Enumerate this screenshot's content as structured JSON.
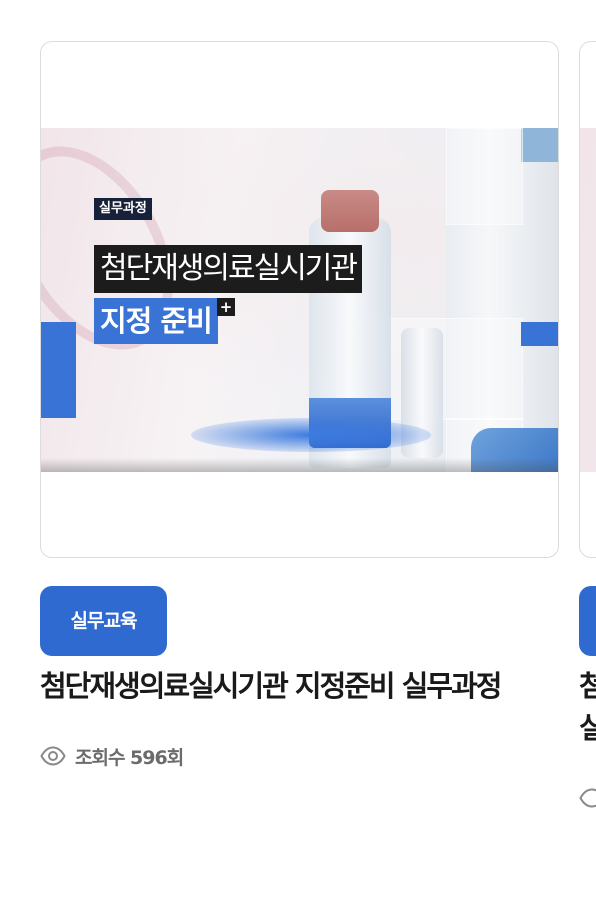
{
  "cards": [
    {
      "thumbnail": {
        "tag": "실무과정",
        "line1": "첨단재생의료실시기관",
        "line2": "지정 준비",
        "plus": "+"
      },
      "badge": "실무교육",
      "title": "첨단재생의료실시기관 지정준비 실무과정",
      "views": "조회수 596회",
      "views_icon": "eye-icon"
    },
    {
      "title_partial": "첨",
      "title_partial_line2": "실"
    }
  ],
  "colors": {
    "badge_bg": "#2f6ad0",
    "title_text": "#1a1a1a",
    "views_text": "#6b6b6b",
    "accent_blue": "#3a73d6"
  }
}
